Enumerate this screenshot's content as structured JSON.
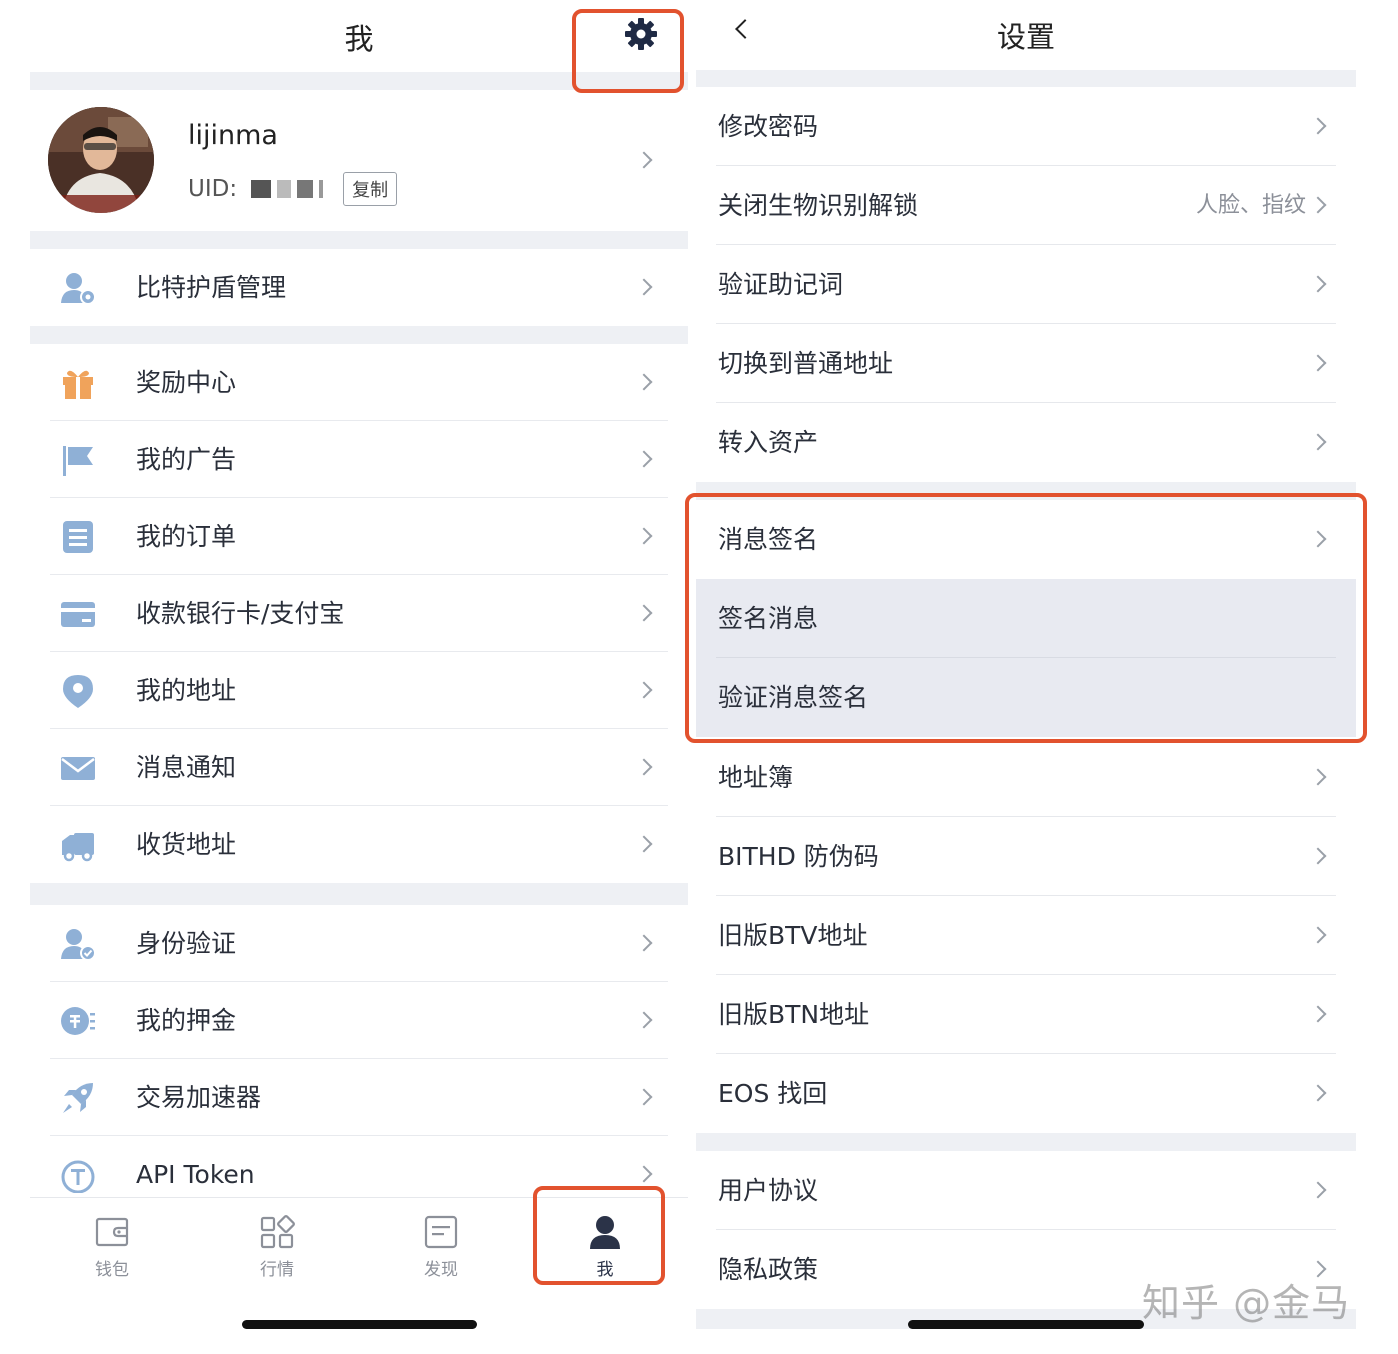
{
  "left": {
    "title": "我",
    "profile": {
      "name": "lijinma",
      "uid_label": "UID:",
      "copy_label": "复制"
    },
    "groups": [
      [
        {
          "label": "比特护盾管理",
          "icon": "user-gear-icon"
        }
      ],
      [
        {
          "label": "奖励中心",
          "icon": "gift-icon"
        },
        {
          "label": "我的广告",
          "icon": "flag-icon"
        },
        {
          "label": "我的订单",
          "icon": "order-list-icon"
        },
        {
          "label": "收款银行卡/支付宝",
          "icon": "bank-card-icon"
        },
        {
          "label": "我的地址",
          "icon": "location-pin-icon"
        },
        {
          "label": "消息通知",
          "icon": "mail-icon"
        },
        {
          "label": "收货地址",
          "icon": "truck-icon"
        }
      ],
      [
        {
          "label": "身份验证",
          "icon": "user-check-icon"
        },
        {
          "label": "我的押金",
          "icon": "deposit-icon"
        },
        {
          "label": "交易加速器",
          "icon": "rocket-icon"
        },
        {
          "label": "API Token",
          "icon": "token-icon"
        }
      ]
    ],
    "tabs": [
      {
        "label": "钱包",
        "icon": "wallet-icon"
      },
      {
        "label": "行情",
        "icon": "market-grid-icon"
      },
      {
        "label": "发现",
        "icon": "discover-icon"
      },
      {
        "label": "我",
        "icon": "person-icon"
      }
    ],
    "active_tab": "我"
  },
  "right": {
    "title": "设置",
    "groups": [
      [
        {
          "label": "修改密码"
        },
        {
          "label": "关闭生物识别解锁",
          "value": "人脸、指纹"
        },
        {
          "label": "验证助记词"
        },
        {
          "label": "切换到普通地址"
        },
        {
          "label": "转入资产"
        }
      ],
      [
        {
          "label": "消息签名"
        },
        {
          "label": "签名消息"
        },
        {
          "label": "验证消息签名"
        },
        {
          "label": "地址簿"
        },
        {
          "label": "BITHD 防伪码"
        },
        {
          "label": "旧版BTV地址"
        },
        {
          "label": "旧版BTN地址"
        },
        {
          "label": "EOS 找回"
        }
      ],
      [
        {
          "label": "用户协议"
        },
        {
          "label": "隐私政策"
        }
      ]
    ]
  },
  "watermark": "知乎 @金马",
  "colors": {
    "highlight": "#e2522e",
    "icon_blue": "#8fb0d6",
    "gift_orange": "#f0a35b",
    "section_gap": "#eef0f4",
    "shaded_row": "#e8eaf1",
    "active_tab": "#2b3348"
  }
}
